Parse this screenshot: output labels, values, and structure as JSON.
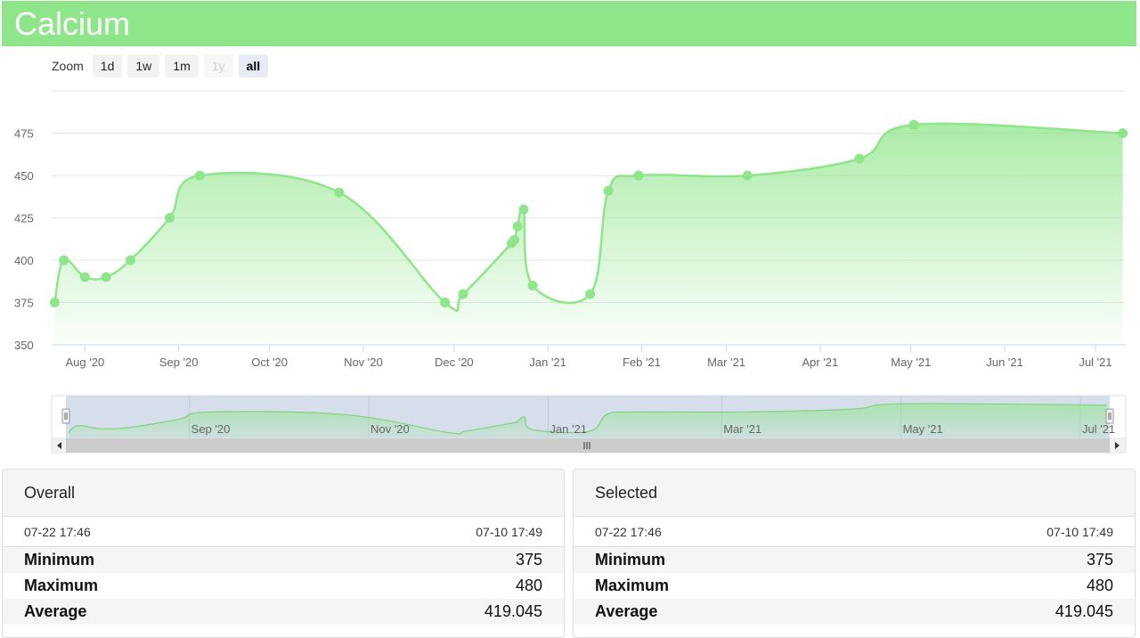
{
  "header": {
    "title": "Calcium"
  },
  "zoom": {
    "label": "Zoom",
    "buttons": [
      {
        "label": "1d",
        "state": "normal"
      },
      {
        "label": "1w",
        "state": "normal"
      },
      {
        "label": "1m",
        "state": "normal"
      },
      {
        "label": "1y",
        "state": "disabled"
      },
      {
        "label": "all",
        "state": "active"
      }
    ]
  },
  "colors": {
    "series": "#8fe58a",
    "header": "#8fe58a",
    "navigator_fill": "#cfd8e8"
  },
  "chart_data": {
    "type": "area",
    "title": "",
    "xlabel": "",
    "ylabel": "",
    "ylim": [
      350,
      500
    ],
    "xlim": [
      "2020-07-21",
      "2021-07-11"
    ],
    "y_ticks": [
      "350",
      "375",
      "400",
      "425",
      "450",
      "475"
    ],
    "x_ticks": [
      "Aug '20",
      "Sep '20",
      "Oct '20",
      "Nov '20",
      "Dec '20",
      "Jan '21",
      "Feb '21",
      "Mar '21",
      "Apr '21",
      "May '21",
      "Jun '21",
      "Jul '21"
    ],
    "navigator_ticks": [
      "Sep '20",
      "Nov '20",
      "Jan '21",
      "Mar '21",
      "May '21",
      "Jul '21"
    ],
    "grid": true,
    "legend": "none",
    "series": [
      {
        "points": [
          [
            "2020-07-22",
            375
          ],
          [
            "2020-07-25",
            400
          ],
          [
            "2020-08-01",
            390
          ],
          [
            "2020-08-08",
            390
          ],
          [
            "2020-08-16",
            400
          ],
          [
            "2020-08-29",
            425
          ],
          [
            "2020-09-08",
            450
          ],
          [
            "2020-10-24",
            440
          ],
          [
            "2020-11-28",
            375
          ],
          [
            "2020-12-04",
            380
          ],
          [
            "2020-12-20",
            410
          ],
          [
            "2020-12-21",
            412
          ],
          [
            "2020-12-22",
            420
          ],
          [
            "2020-12-24",
            430
          ],
          [
            "2020-12-27",
            385
          ],
          [
            "2021-01-15",
            380
          ],
          [
            "2021-01-21",
            441
          ],
          [
            "2021-01-31",
            450
          ],
          [
            "2021-03-08",
            450
          ],
          [
            "2021-04-14",
            460
          ],
          [
            "2021-05-02",
            480
          ],
          [
            "2021-07-10",
            475
          ]
        ]
      }
    ]
  },
  "panels": [
    {
      "title": "Overall",
      "start": "07-22 17:46",
      "end": "07-10 17:49",
      "stats": [
        {
          "label": "Minimum",
          "value": "375"
        },
        {
          "label": "Maximum",
          "value": "480"
        },
        {
          "label": "Average",
          "value": "419.045"
        }
      ]
    },
    {
      "title": "Selected",
      "start": "07-22 17:46",
      "end": "07-10 17:49",
      "stats": [
        {
          "label": "Minimum",
          "value": "375"
        },
        {
          "label": "Maximum",
          "value": "480"
        },
        {
          "label": "Average",
          "value": "419.045"
        }
      ]
    }
  ]
}
